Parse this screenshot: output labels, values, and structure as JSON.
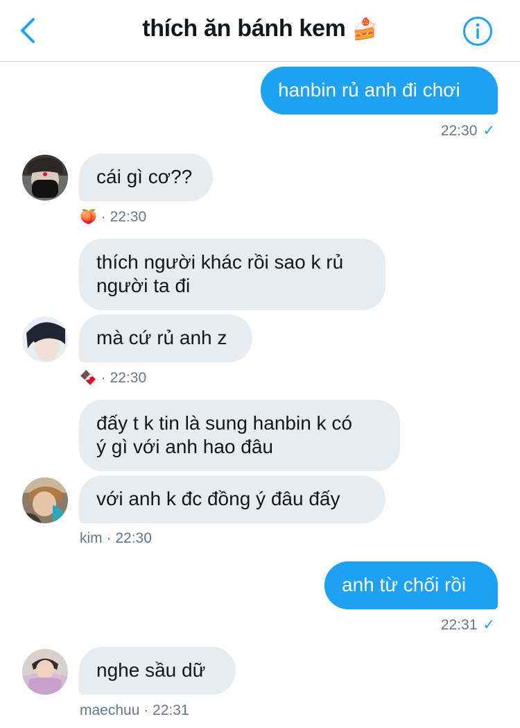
{
  "header": {
    "title": "thích ăn bánh kem",
    "title_emoji": "🍰"
  },
  "messages": [
    {
      "text": "hanbin rủ anh đi chơi",
      "time": "22:30",
      "check": "✓"
    },
    {
      "text": "cái gì cơ??",
      "reaction": "🍑",
      "time": "· 22:30"
    },
    {
      "line1": "thích người khác rồi sao k rủ",
      "line2": "người ta đi"
    },
    {
      "text": "mà cứ rủ anh z",
      "reaction": "🍫",
      "time": "· 22:30"
    },
    {
      "line1": "đấy t k tin là sung hanbin k có",
      "line2": "ý gì với anh hao đâu"
    },
    {
      "text": "với anh k đc đồng ý đâu đấy",
      "sender": "kim",
      "time": "· 22:30"
    },
    {
      "text": "anh từ chối rồi",
      "time": "22:31",
      "check": "✓"
    },
    {
      "text": "nghe sầu dữ",
      "sender": "maechuu",
      "time": "· 22:31"
    }
  ]
}
